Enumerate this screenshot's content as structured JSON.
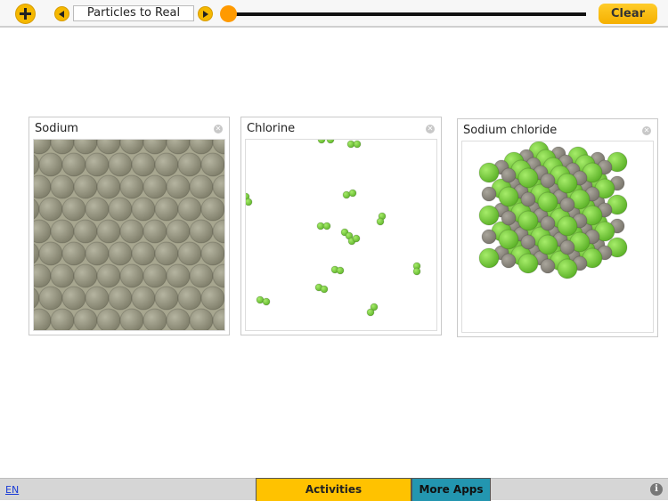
{
  "toolbar": {
    "add_icon": "plus-icon",
    "prev_icon": "triangle-left-icon",
    "next_icon": "triangle-right-icon",
    "activity_title": "Particles to Real",
    "slider_value": 0,
    "clear_label": "Clear"
  },
  "panels": [
    {
      "title": "Sodium",
      "close_icon": "close-icon",
      "view": "metal-lattice-closepacked"
    },
    {
      "title": "Chlorine",
      "close_icon": "close-icon",
      "view": "gas-diatomic-molecules"
    },
    {
      "title": "Sodium chloride",
      "close_icon": "close-icon",
      "view": "ionic-crystal-cube"
    }
  ],
  "colors": {
    "accent_yellow": "#f5b800",
    "slider_thumb": "#ff9a00",
    "sodium_atom": "#9e9d86",
    "chlorine_atom": "#7fd23e",
    "na_ion": "#8e8a80",
    "more_apps_tab": "#2396b0"
  },
  "footer": {
    "language": "EN",
    "tabs": [
      {
        "label": "Activities",
        "active": true
      },
      {
        "label": "More Apps",
        "active": false
      }
    ],
    "info_icon": "i"
  }
}
